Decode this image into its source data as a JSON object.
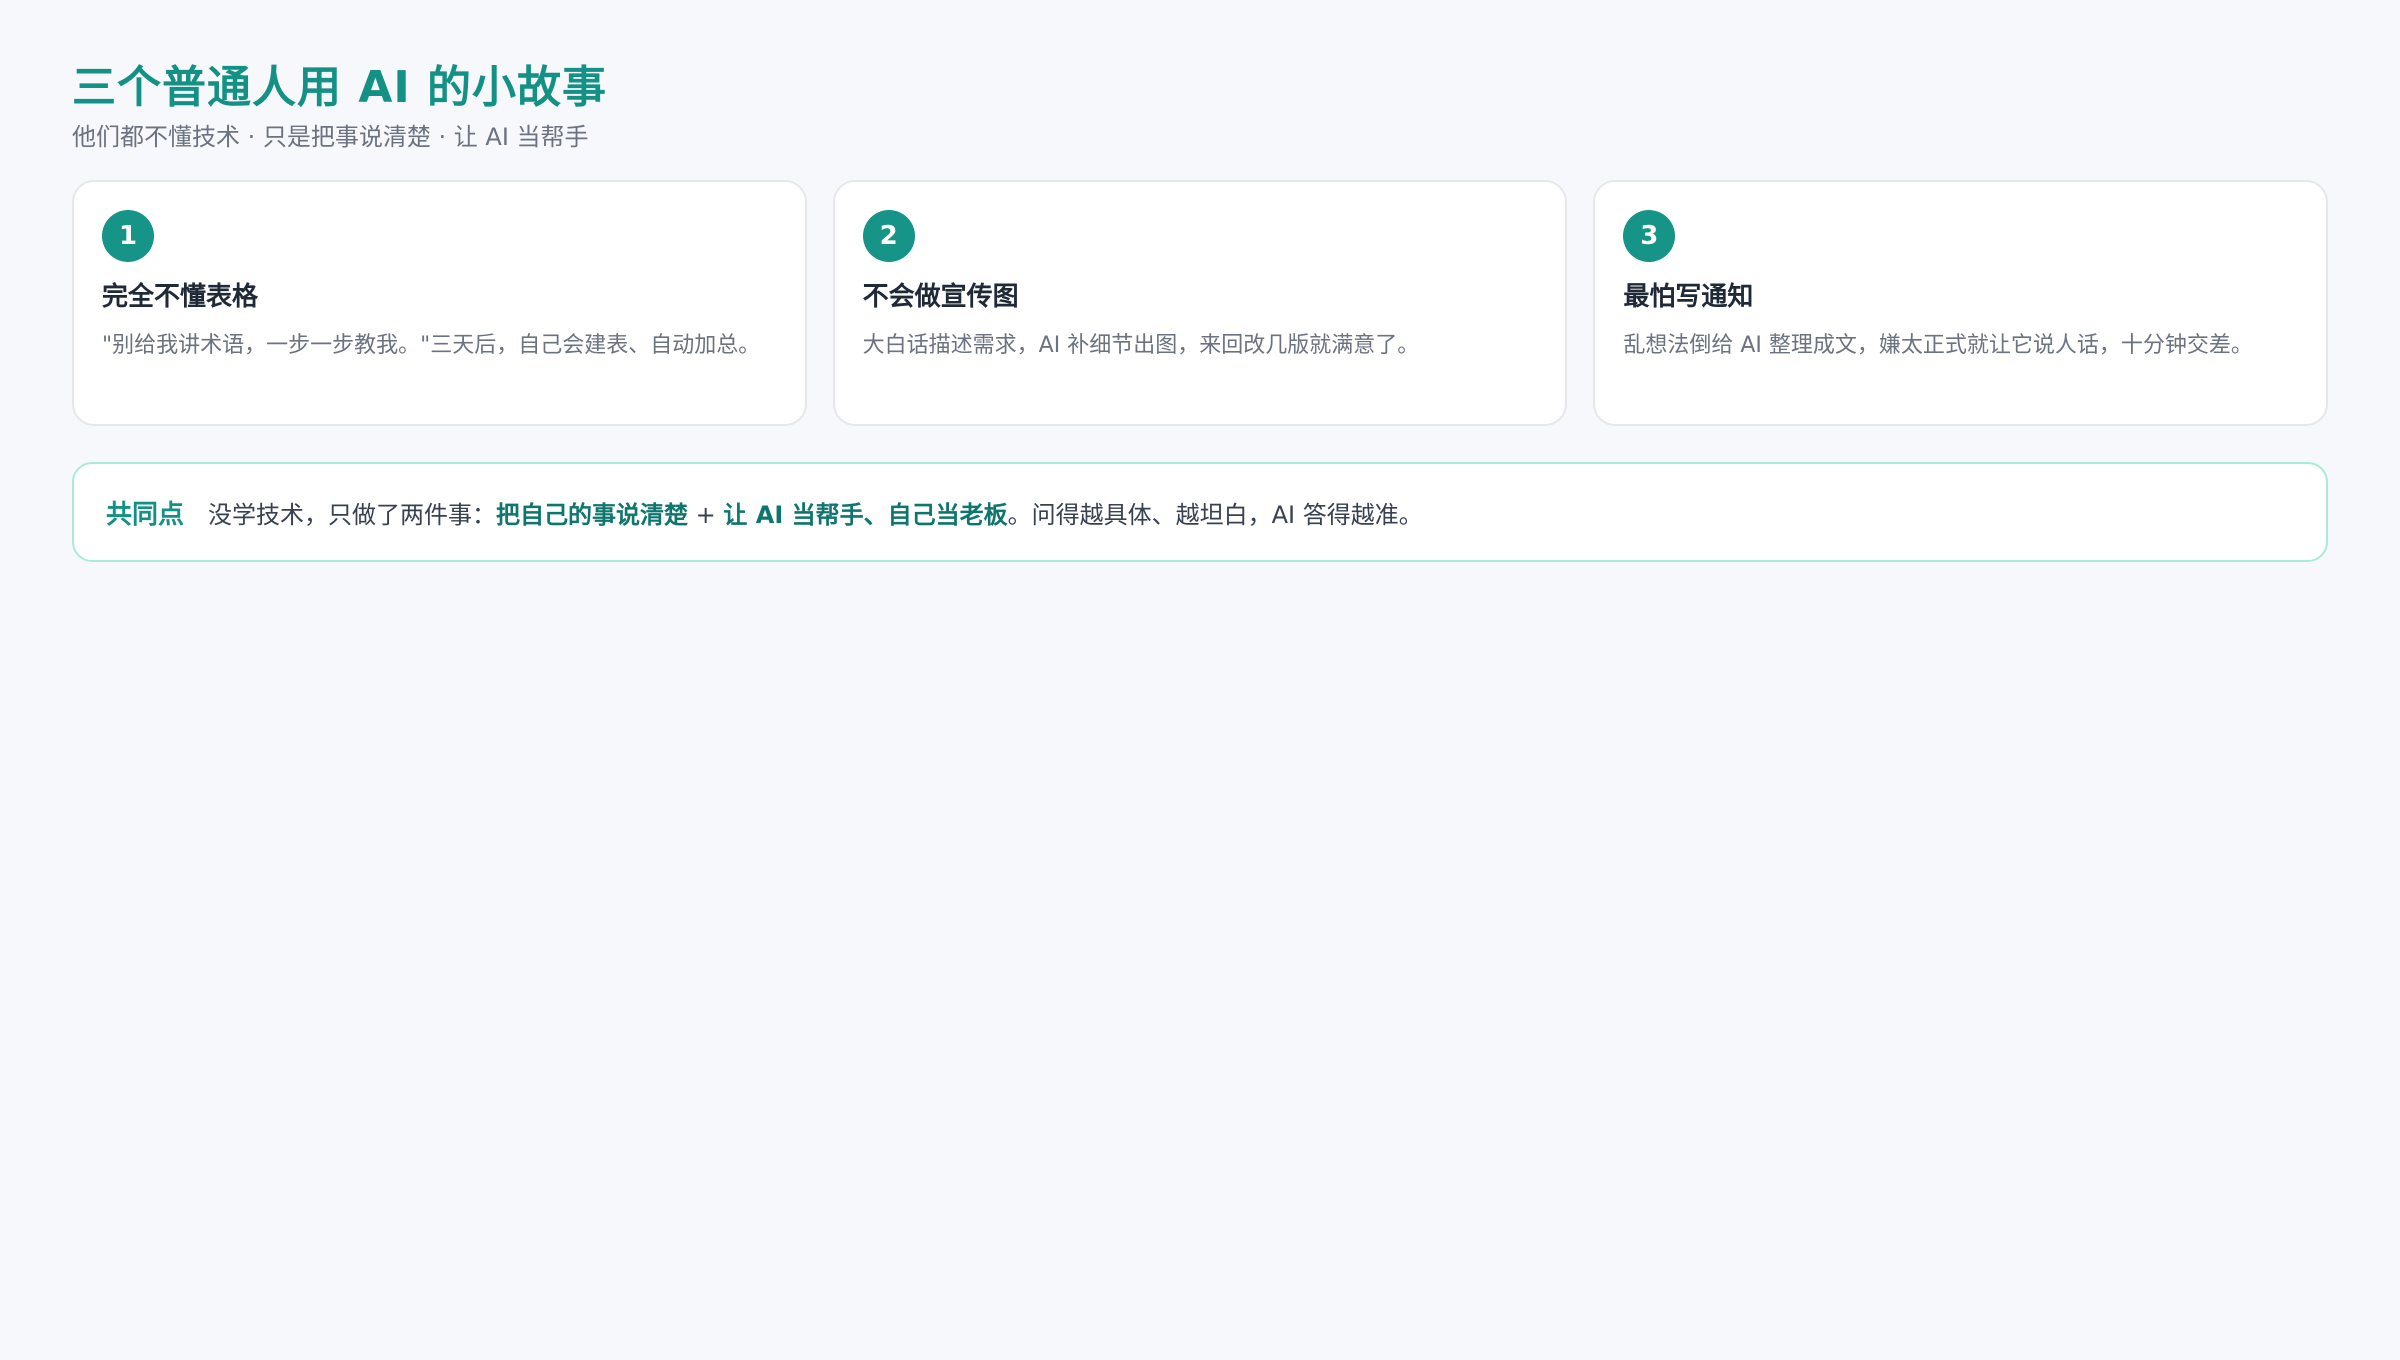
{
  "header": {
    "title": "三个普通人用 AI 的小故事",
    "subtitle": "他们都不懂技术 · 只是把事说清楚 · 让 AI 当帮手"
  },
  "cards": [
    {
      "number": "1",
      "title": "完全不懂表格",
      "description": "\"别给我讲术语，一步一步教我。\"三天后，自己会建表、自动加总。"
    },
    {
      "number": "2",
      "title": "不会做宣传图",
      "description": "大白话描述需求，AI 补细节出图，来回改几版就满意了。"
    },
    {
      "number": "3",
      "title": "最怕写通知",
      "description": "乱想法倒给 AI 整理成文，嫌太正式就让它说人话，十分钟交差。"
    }
  ],
  "common": {
    "label": "共同点",
    "text_before": "没学技术，只做了两件事：",
    "highlight_1": "把自己的事说清楚",
    "plus": " + ",
    "highlight_2": "让 AI 当帮手、自己当老板",
    "text_after": "。问得越具体、越坦白，AI 答得越准。"
  },
  "colors": {
    "accent": "#149185",
    "background": "#f7f8fb",
    "card_border": "#e5e7eb",
    "common_border": "#a7ebd9"
  }
}
